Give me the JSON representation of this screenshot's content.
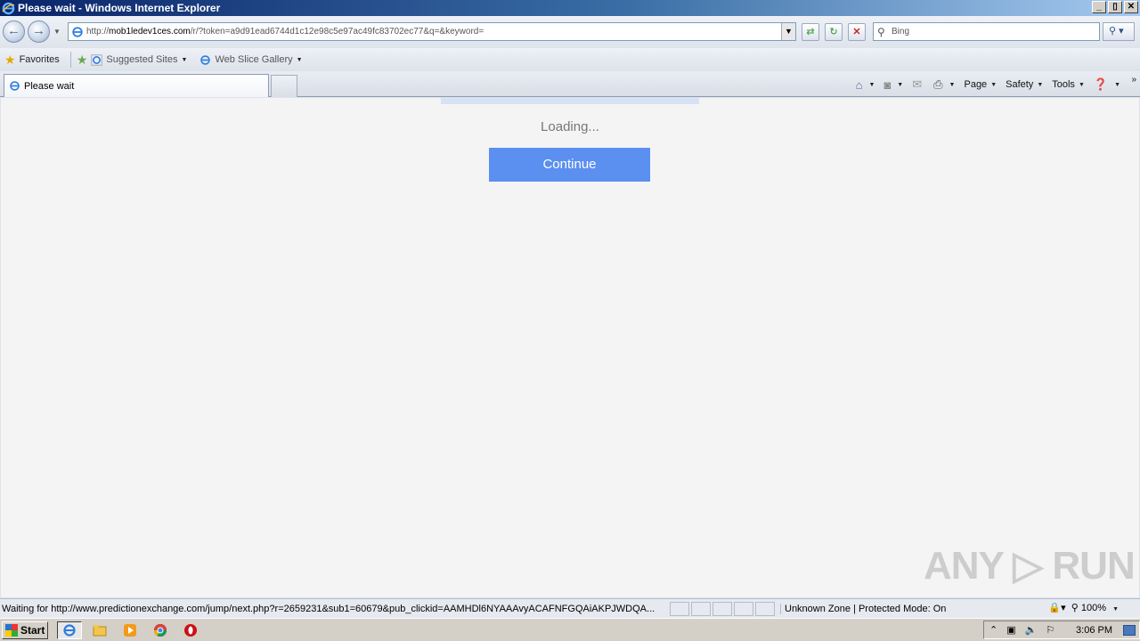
{
  "window": {
    "title": "Please wait - Windows Internet Explorer",
    "minimize": "_",
    "restore": "▯",
    "close": "✕"
  },
  "address": {
    "url_prefix": "http://",
    "url_domain": "mob1ledev1ces.com",
    "url_path": "/r/?token=a9d91ead6744d1c12e98c5e97ac49fc83702ec77&q=&keyword="
  },
  "search": {
    "placeholder": "Bing"
  },
  "favorites": {
    "favorites_label": "Favorites",
    "suggested_sites": "Suggested Sites",
    "web_slice_gallery": "Web Slice Gallery"
  },
  "tabs": [
    {
      "label": "Please wait"
    }
  ],
  "commandbar": {
    "page": "Page",
    "safety": "Safety",
    "tools": "Tools"
  },
  "content": {
    "loading_text": "Loading...",
    "continue_label": "Continue",
    "watermark": "ANY ▷ RUN"
  },
  "status": {
    "message": "Waiting for http://www.predictionexchange.com/jump/next.php?r=2659231&sub1=60679&pub_clickid=AAMHDl6NYAAAvyACAFNFGQAiAKPJWDQA...",
    "zone": "Unknown Zone | Protected Mode: On",
    "zoom": "100%"
  },
  "taskbar": {
    "start_label": "Start",
    "clock": "3:06 PM"
  },
  "colors": {
    "continue_button": "#5b8ff0",
    "titlebar_start": "#0a246a",
    "titlebar_end": "#a6caf0"
  }
}
